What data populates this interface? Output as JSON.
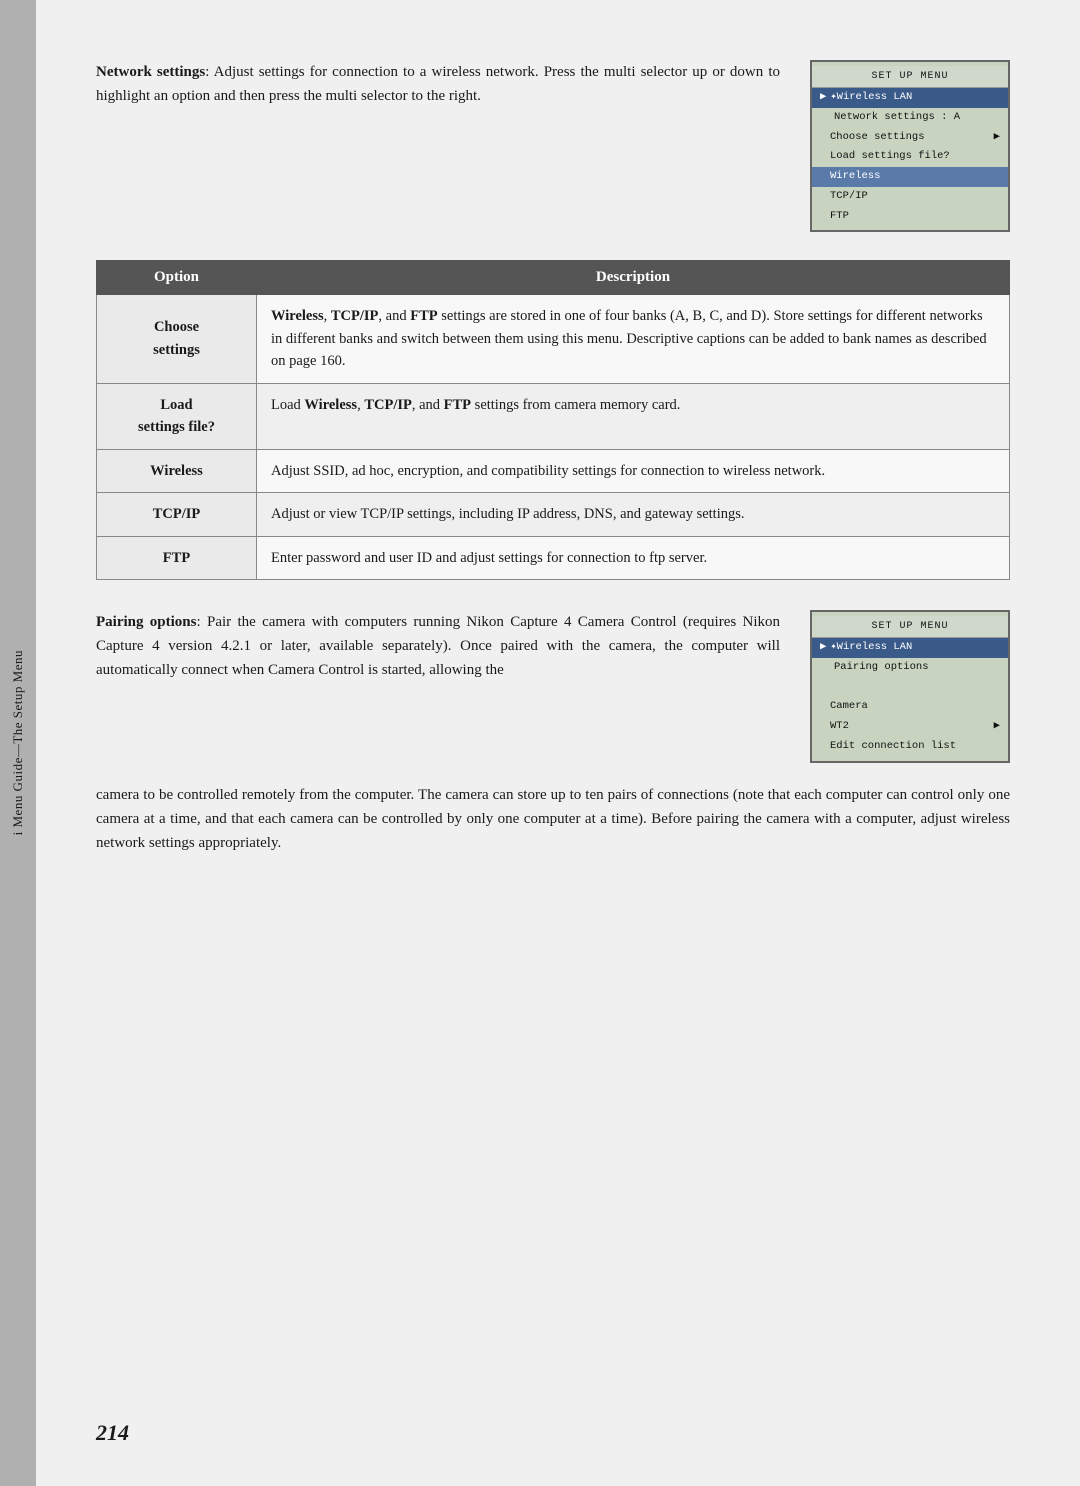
{
  "sidebar": {
    "label": "i Menu Guide—The Setup Menu"
  },
  "top_section": {
    "heading": "Network settings",
    "text": ": Adjust settings for connection to a wireless network.  Press the multi selector up or down to highlight an option and then press the multi selector to the right."
  },
  "lcd1": {
    "title": "SET UP MENU",
    "rows": [
      {
        "label": "✦Wireless LAN",
        "highlighted": true
      },
      {
        "label": "Network settings : A",
        "indent": false
      },
      {
        "label": "Choose settings",
        "indent": true,
        "arrow": true
      },
      {
        "label": "Load settings file?",
        "indent": true
      },
      {
        "label": "Wireless",
        "indent": true,
        "selected": true
      },
      {
        "label": "TCP/IP",
        "indent": true
      },
      {
        "label": "FTP",
        "indent": true
      }
    ]
  },
  "table": {
    "headers": [
      "Option",
      "Description"
    ],
    "rows": [
      {
        "option": "Choose\nsettings",
        "description_parts": [
          {
            "bold": true,
            "text": "Wireless"
          },
          {
            "bold": false,
            "text": ", "
          },
          {
            "bold": true,
            "text": "TCP/IP"
          },
          {
            "bold": false,
            "text": ", and "
          },
          {
            "bold": true,
            "text": "FTP"
          },
          {
            "bold": false,
            "text": " settings are stored in one of four banks (A, B, C, and D).  Store settings for different networks in different banks and switch between them using this menu.  Descriptive captions can be added to bank names as described on page 160."
          }
        ]
      },
      {
        "option": "Load\nsettings file?",
        "description_parts": [
          {
            "bold": false,
            "text": "Load "
          },
          {
            "bold": true,
            "text": "Wireless"
          },
          {
            "bold": false,
            "text": ", "
          },
          {
            "bold": true,
            "text": "TCP/IP"
          },
          {
            "bold": false,
            "text": ", and "
          },
          {
            "bold": true,
            "text": "FTP"
          },
          {
            "bold": false,
            "text": " settings from camera memory card."
          }
        ]
      },
      {
        "option": "Wireless",
        "description": "Adjust SSID, ad hoc, encryption, and compatibility settings for connection to wireless network."
      },
      {
        "option": "TCP/IP",
        "description": "Adjust or view TCP/IP settings, including IP address, DNS, and gateway settings."
      },
      {
        "option": "FTP",
        "description": "Enter password and user ID and adjust settings for connection to ftp server."
      }
    ]
  },
  "bottom_section": {
    "heading": "Pairing options",
    "text": ": Pair the camera with computers running Nikon Capture 4 Camera Control (requires Nikon Capture 4 version 4.2.1 or later, available separately).  Once paired with the camera, the computer will automatically connect when Camera Control is started, allowing the"
  },
  "lcd2": {
    "title": "SET UP MENU",
    "rows": [
      {
        "label": "✦Wireless LAN",
        "highlighted": true
      },
      {
        "label": "Pairing options",
        "indent": false
      },
      {
        "label": ""
      },
      {
        "label": "Camera",
        "indent": true
      },
      {
        "label": "WT2",
        "indent": true,
        "arrow": true
      },
      {
        "label": "Edit connection list",
        "indent": true
      }
    ]
  },
  "bottom_continuation": "camera to be controlled remotely from the computer.  The camera can store up to ten pairs of connections (note that each computer can control only one camera at a time, and that each camera can be controlled by only one computer at a time).  Before pairing the camera with a computer, adjust wireless network settings appropriately.",
  "page_number": "214"
}
